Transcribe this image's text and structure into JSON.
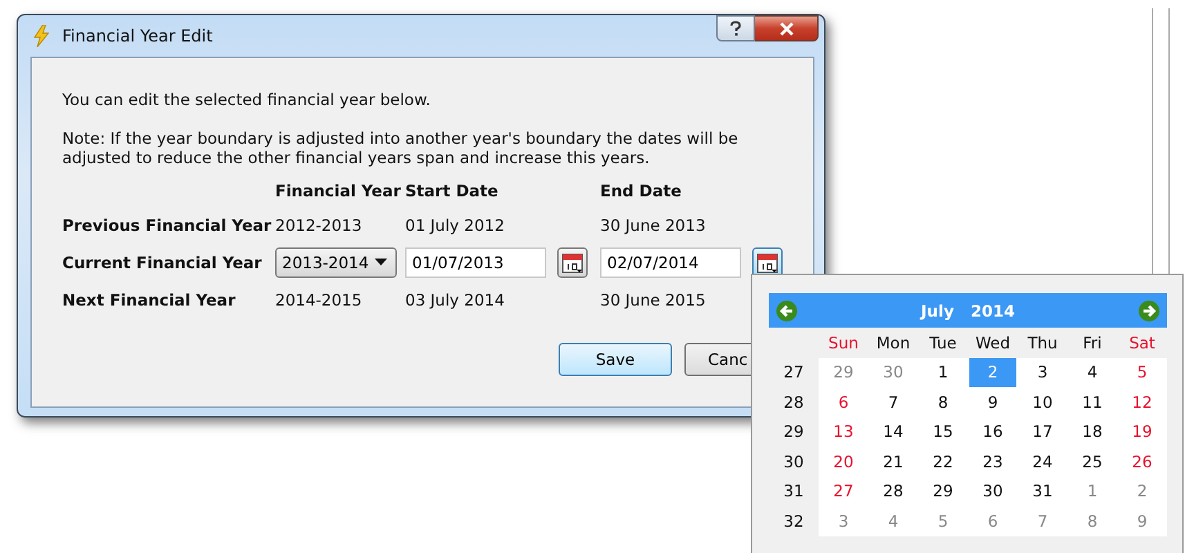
{
  "dialog": {
    "title": "Financial Year Edit",
    "intro": "You can edit the selected financial year below.",
    "note": "Note: If the year boundary is adjusted into another year's boundary the dates will be adjusted to reduce the other financial years span and increase this years.",
    "columns": [
      "Financial Year",
      "Start Date",
      "End Date"
    ],
    "rows": [
      {
        "label": "Previous Financial Year",
        "kind": "text",
        "year": "2012-2013",
        "start": "01 July 2012",
        "end": "30 June 2013"
      },
      {
        "label": "Current Financial Year",
        "kind": "edit",
        "year": "2013-2014",
        "start": "01/07/2013",
        "end": "02/07/2014"
      },
      {
        "label": "Next Financial Year",
        "kind": "text",
        "year": "2014-2015",
        "start": "03 July 2014",
        "end": "30 June 2015"
      }
    ],
    "buttons": [
      {
        "label": "Save",
        "default": true
      },
      {
        "label": "Canc",
        "default": false
      }
    ]
  },
  "calendar": {
    "month": "July",
    "year": "2014",
    "weekdays": [
      "Sun",
      "Mon",
      "Tue",
      "Wed",
      "Thu",
      "Fri",
      "Sat"
    ],
    "weeks": [
      {
        "week": "27",
        "days": [
          {
            "text": "29",
            "muted": true,
            "selected": false
          },
          {
            "text": "30",
            "muted": true,
            "selected": false
          },
          {
            "text": "1",
            "muted": false,
            "selected": false
          },
          {
            "text": "2",
            "muted": false,
            "selected": true
          },
          {
            "text": "3",
            "muted": false,
            "selected": false
          },
          {
            "text": "4",
            "muted": false,
            "selected": false
          },
          {
            "text": "5",
            "muted": false,
            "selected": false
          }
        ]
      },
      {
        "week": "28",
        "days": [
          {
            "text": "6",
            "muted": false,
            "selected": false
          },
          {
            "text": "7",
            "muted": false,
            "selected": false
          },
          {
            "text": "8",
            "muted": false,
            "selected": false
          },
          {
            "text": "9",
            "muted": false,
            "selected": false
          },
          {
            "text": "10",
            "muted": false,
            "selected": false
          },
          {
            "text": "11",
            "muted": false,
            "selected": false
          },
          {
            "text": "12",
            "muted": false,
            "selected": false
          }
        ]
      },
      {
        "week": "29",
        "days": [
          {
            "text": "13",
            "muted": false,
            "selected": false
          },
          {
            "text": "14",
            "muted": false,
            "selected": false
          },
          {
            "text": "15",
            "muted": false,
            "selected": false
          },
          {
            "text": "16",
            "muted": false,
            "selected": false
          },
          {
            "text": "17",
            "muted": false,
            "selected": false
          },
          {
            "text": "18",
            "muted": false,
            "selected": false
          },
          {
            "text": "19",
            "muted": false,
            "selected": false
          }
        ]
      },
      {
        "week": "30",
        "days": [
          {
            "text": "20",
            "muted": false,
            "selected": false
          },
          {
            "text": "21",
            "muted": false,
            "selected": false
          },
          {
            "text": "22",
            "muted": false,
            "selected": false
          },
          {
            "text": "23",
            "muted": false,
            "selected": false
          },
          {
            "text": "24",
            "muted": false,
            "selected": false
          },
          {
            "text": "25",
            "muted": false,
            "selected": false
          },
          {
            "text": "26",
            "muted": false,
            "selected": false
          }
        ]
      },
      {
        "week": "31",
        "days": [
          {
            "text": "27",
            "muted": false,
            "selected": false
          },
          {
            "text": "28",
            "muted": false,
            "selected": false
          },
          {
            "text": "29",
            "muted": false,
            "selected": false
          },
          {
            "text": "30",
            "muted": false,
            "selected": false
          },
          {
            "text": "31",
            "muted": false,
            "selected": false
          },
          {
            "text": "1",
            "muted": true,
            "selected": false
          },
          {
            "text": "2",
            "muted": true,
            "selected": false
          }
        ]
      },
      {
        "week": "32",
        "days": [
          {
            "text": "3",
            "muted": true,
            "selected": false
          },
          {
            "text": "4",
            "muted": true,
            "selected": false
          },
          {
            "text": "5",
            "muted": true,
            "selected": false
          },
          {
            "text": "6",
            "muted": true,
            "selected": false
          },
          {
            "text": "7",
            "muted": true,
            "selected": false
          },
          {
            "text": "8",
            "muted": true,
            "selected": false
          },
          {
            "text": "9",
            "muted": true,
            "selected": false
          }
        ]
      }
    ]
  }
}
